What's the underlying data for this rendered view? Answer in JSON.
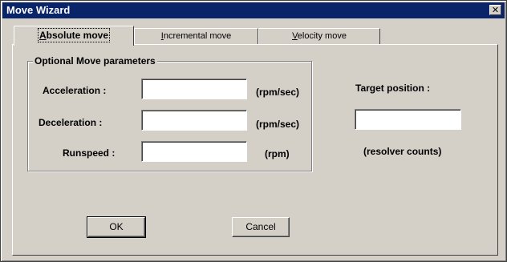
{
  "window": {
    "title": "Move Wizard",
    "close_glyph": "✕"
  },
  "tabs": [
    {
      "label": "Absolute move",
      "accel": "A",
      "rest": "bsolute move",
      "active": true
    },
    {
      "label": "Incremental move",
      "accel": "I",
      "rest": "ncremental move",
      "active": false
    },
    {
      "label": "Velocity move",
      "accel": "V",
      "rest": "elocity move",
      "active": false
    }
  ],
  "optional_group": {
    "legend": "Optional Move parameters",
    "acceleration": {
      "label": "Acceleration :",
      "value": "",
      "unit": "(rpm/sec)"
    },
    "deceleration": {
      "label": "Deceleration :",
      "value": "",
      "unit": "(rpm/sec)"
    },
    "runspeed": {
      "label": "Runspeed :",
      "value": "",
      "unit": "(rpm)"
    }
  },
  "target": {
    "label": "Target position :",
    "value": "",
    "unit": "(resolver counts)"
  },
  "buttons": {
    "ok": "OK",
    "cancel": "Cancel"
  }
}
